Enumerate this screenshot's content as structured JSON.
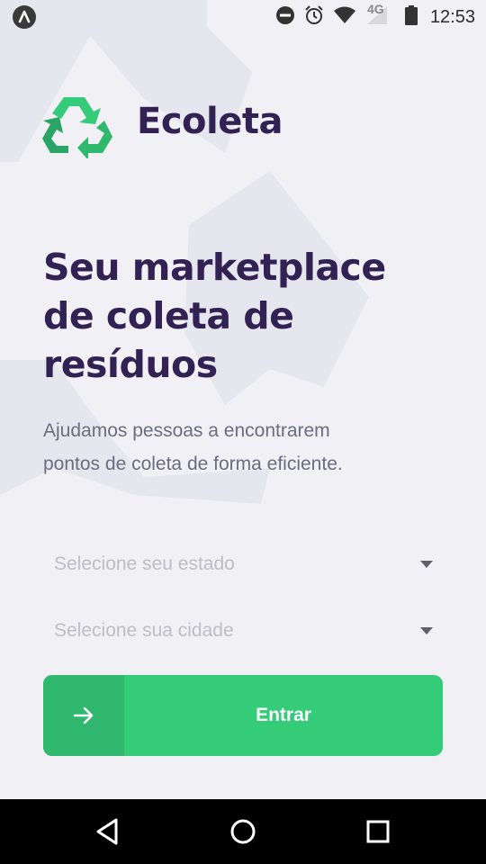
{
  "status_bar": {
    "time": "12:53",
    "network": "4G",
    "icons": [
      "dnd-icon",
      "alarm-icon",
      "wifi-icon",
      "signal-icon",
      "battery-icon"
    ]
  },
  "app": {
    "name": "Ecoleta",
    "logo_icon": "recycle-icon"
  },
  "hero": {
    "headline_lines": [
      "Seu marketplace",
      "de coleta de",
      "resíduos"
    ],
    "subtitle_lines": [
      "Ajudamos pessoas a encontrarem",
      "pontos de coleta de forma eficiente."
    ]
  },
  "form": {
    "state_placeholder": "Selecione seu estado",
    "city_placeholder": "Selecione sua cidade",
    "submit_label": "Entrar",
    "submit_icon": "arrow-right-icon"
  },
  "colors": {
    "background": "#f0f0f5",
    "title": "#322153",
    "text": "#6c6c80",
    "primary": "#34cb79",
    "primary_dark": "#2fb86e",
    "placeholder": "#bdbdc6"
  },
  "nav_bar": {
    "icons": [
      "back-icon",
      "home-icon",
      "recents-icon"
    ]
  }
}
